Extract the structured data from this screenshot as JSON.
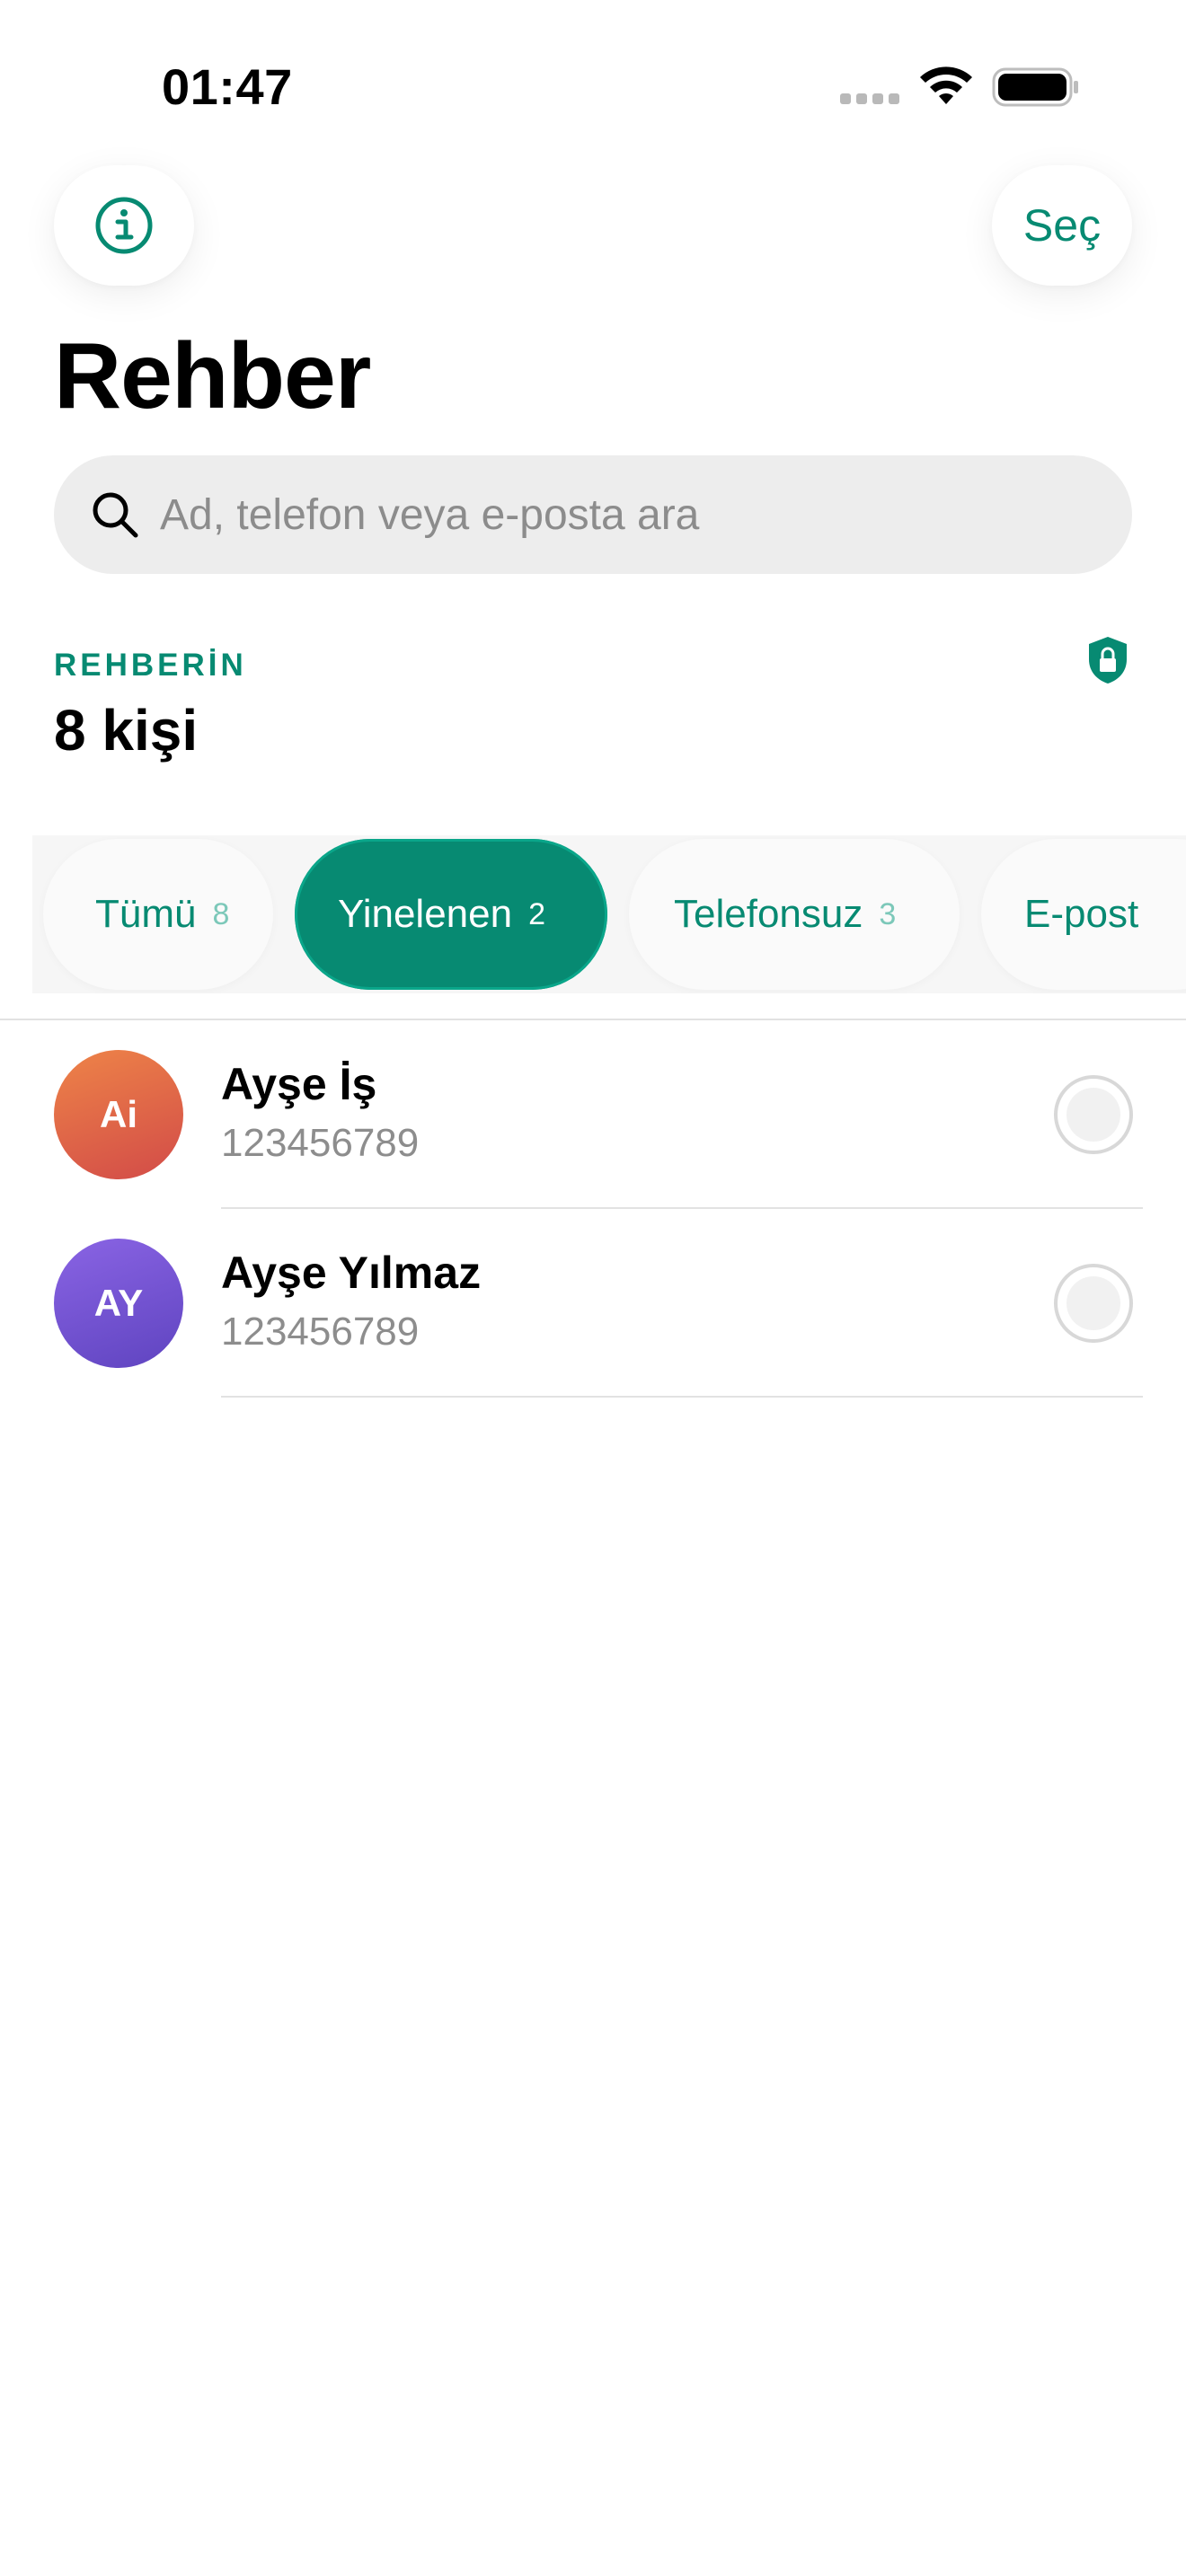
{
  "status_bar": {
    "time": "01:47"
  },
  "header": {
    "select_label": "Seç",
    "title": "Rehber"
  },
  "search": {
    "placeholder": "Ad, telefon veya e-posta ara",
    "value": ""
  },
  "summary": {
    "label": "REHBERİN",
    "count": "8 kişi"
  },
  "filters": [
    {
      "label": "Tümü",
      "count": "8",
      "active": false
    },
    {
      "label": "Yinelenen",
      "count": "2",
      "active": true
    },
    {
      "label": "Telefonsuz",
      "count": "3",
      "active": false
    },
    {
      "label": "E-post",
      "count": "",
      "active": false
    }
  ],
  "contacts": [
    {
      "initials": "Ai",
      "name": "Ayşe İş",
      "phone": "123456789",
      "selected": false
    },
    {
      "initials": "AY",
      "name": "Ayşe Yılmaz",
      "phone": "123456789",
      "selected": false
    }
  ],
  "colors": {
    "accent": "#078a72",
    "avatar_orange": "#e0664a",
    "avatar_purple": "#7352cf"
  }
}
